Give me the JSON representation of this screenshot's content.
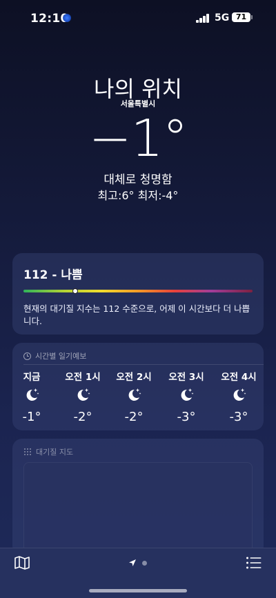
{
  "status_bar": {
    "time": "12:10",
    "network": "5G",
    "battery": "71"
  },
  "header": {
    "title": "나의 위치",
    "city": "서울특별시",
    "temperature": "−1°",
    "condition": "대체로 청명함",
    "hilo": "최고:6°  최저:-4°"
  },
  "air_quality": {
    "title": "112 - 나쁨",
    "value": 112,
    "scale_position": 0.225,
    "description": "현재의 대기질 지수는 112 수준으로, 어제 이 시간보다 더 나쁩니다."
  },
  "hourly": {
    "heading": "시간별 일기예보",
    "items": [
      {
        "time": "지금",
        "icon": "moon-stars-icon",
        "temp": "-1°"
      },
      {
        "time": "오전 1시",
        "icon": "moon-stars-icon",
        "temp": "-2°"
      },
      {
        "time": "오전 2시",
        "icon": "moon-stars-icon",
        "temp": "-2°"
      },
      {
        "time": "오전 3시",
        "icon": "moon-stars-icon",
        "temp": "-3°"
      },
      {
        "time": "오전 4시",
        "icon": "moon-stars-icon",
        "temp": "-3°"
      }
    ]
  },
  "air_map": {
    "heading": "대기질 지도"
  },
  "bottom_bar": {
    "left_icon": "map-icon",
    "right_icon": "list-icon"
  },
  "colors": {
    "accent": "#ffffff",
    "background_top": "#0d1024",
    "background_bottom": "#1e2a5a"
  }
}
